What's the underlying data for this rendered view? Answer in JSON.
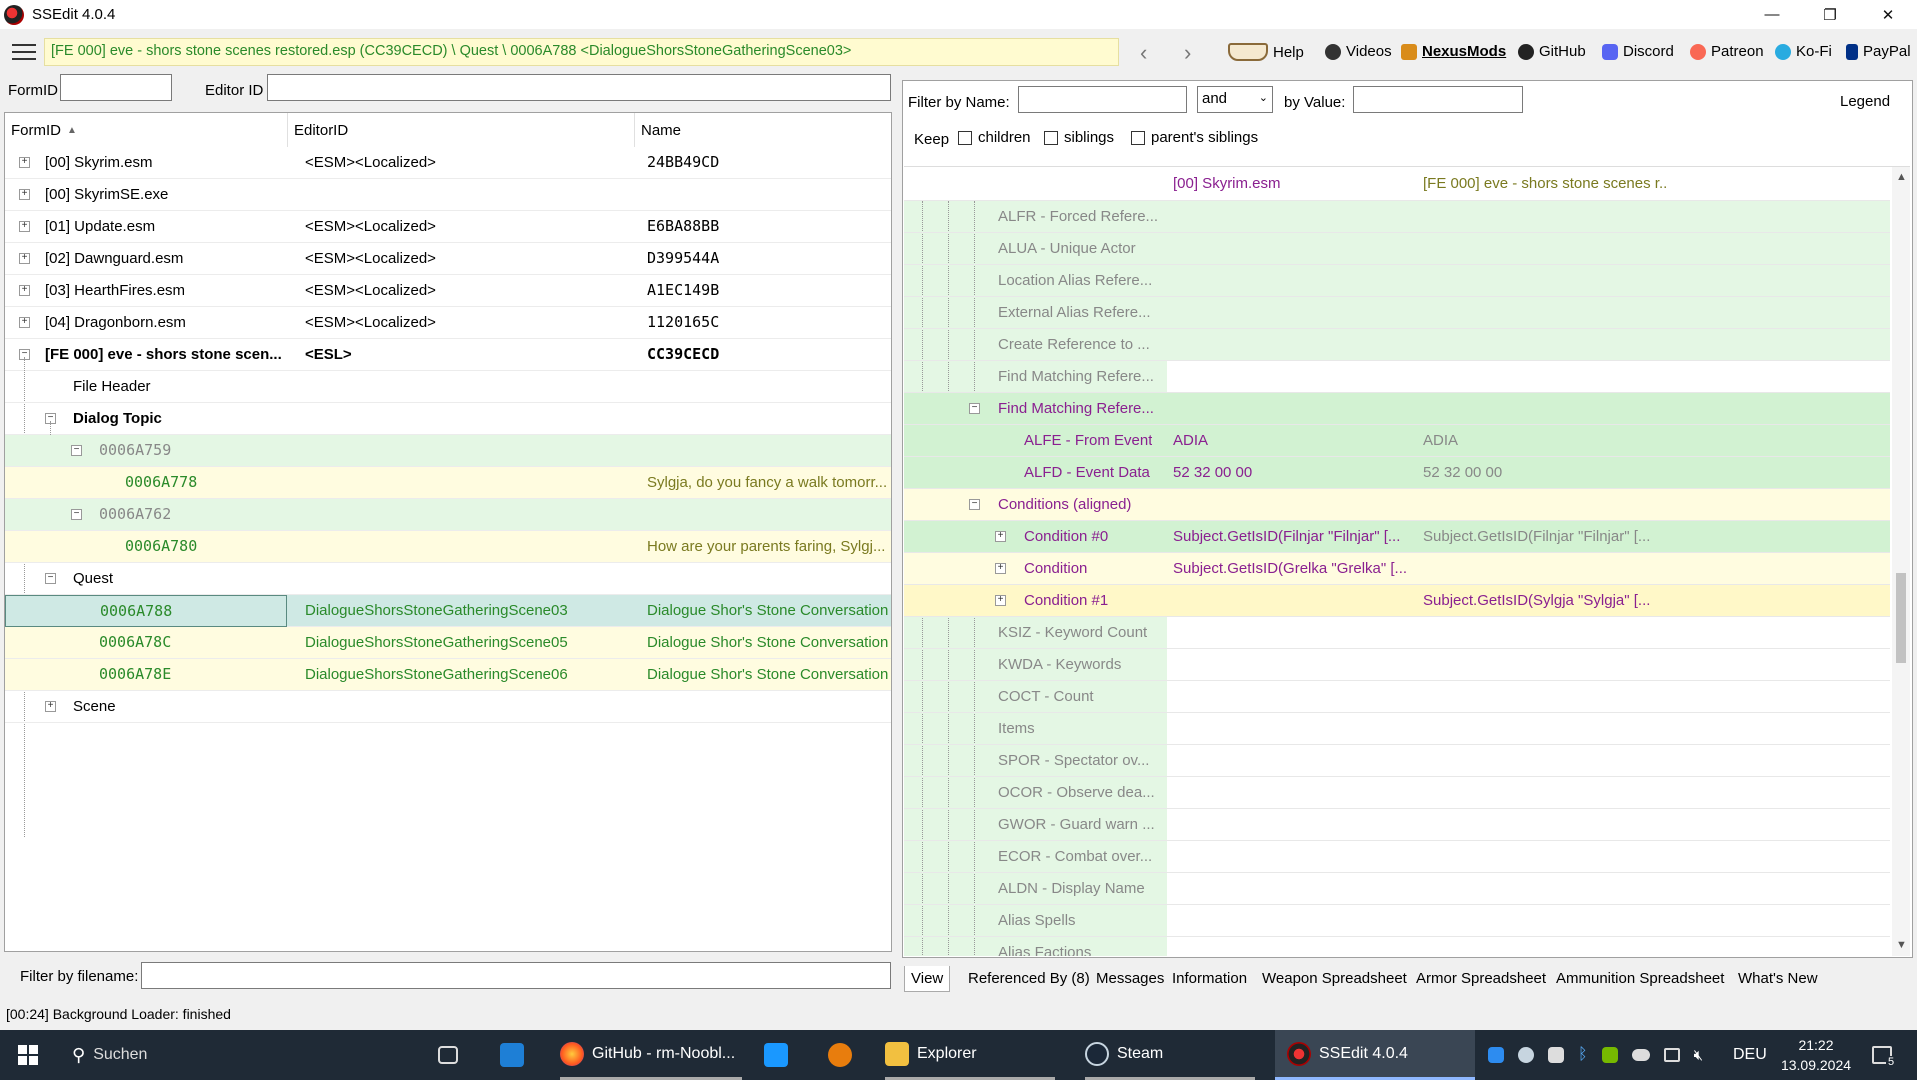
{
  "window": {
    "title": "SSEdit 4.0.4",
    "minimize": "—",
    "maximize": "❐",
    "close": "✕"
  },
  "nav": {
    "path": "[FE 000] eve - shors stone scenes restored.esp (CC39CECD) \\ Quest \\ 0006A788 <DialogueShorsStoneGatheringScene03>",
    "back": "‹",
    "forward": "›",
    "links": [
      "Help",
      "Videos",
      "NexusMods",
      "GitHub",
      "Discord",
      "Patreon",
      "Ko-Fi",
      "PayPal"
    ]
  },
  "left_filter": {
    "formid_label": "FormID",
    "editorid_label": "Editor ID",
    "formid_value": "",
    "editorid_value": ""
  },
  "left_grid": {
    "headers": [
      "FormID",
      "EditorID",
      "Name"
    ],
    "rows": [
      {
        "c1": "[00] Skyrim.esm",
        "c2": "<ESM><Localized>",
        "c3": "24BB49CD"
      },
      {
        "c1": "[00] SkyrimSE.exe",
        "c2": "",
        "c3": ""
      },
      {
        "c1": "[01] Update.esm",
        "c2": "<ESM><Localized>",
        "c3": "E6BA88BB"
      },
      {
        "c1": "[02] Dawnguard.esm",
        "c2": "<ESM><Localized>",
        "c3": "D399544A"
      },
      {
        "c1": "[03] HearthFires.esm",
        "c2": "<ESM><Localized>",
        "c3": "A1EC149B"
      },
      {
        "c1": "[04] Dragonborn.esm",
        "c2": "<ESM><Localized>",
        "c3": "1120165C"
      },
      {
        "c1": "[FE 000] eve - shors stone scen...",
        "c2": "<ESL>",
        "c3": "CC39CECD"
      },
      {
        "c1": "File Header",
        "c2": "",
        "c3": ""
      },
      {
        "c1": "Dialog Topic",
        "c2": "",
        "c3": ""
      },
      {
        "c1": "0006A759",
        "c2": "",
        "c3": ""
      },
      {
        "c1": "0006A778",
        "c2": "",
        "c3": "Sylgja, do you fancy a walk tomorr..."
      },
      {
        "c1": "0006A762",
        "c2": "",
        "c3": ""
      },
      {
        "c1": "0006A780",
        "c2": "",
        "c3": "How are your parents faring, Sylgj..."
      },
      {
        "c1": "Quest",
        "c2": "",
        "c3": ""
      },
      {
        "c1": "0006A788",
        "c2": "DialogueShorsStoneGatheringScene03",
        "c3": "Dialogue Shor's Stone Conversation"
      },
      {
        "c1": "0006A78C",
        "c2": "DialogueShorsStoneGatheringScene05",
        "c3": "Dialogue Shor's Stone Conversation"
      },
      {
        "c1": "0006A78E",
        "c2": "DialogueShorsStoneGatheringScene06",
        "c3": "Dialogue Shor's Stone Conversation"
      },
      {
        "c1": "Scene",
        "c2": "",
        "c3": ""
      }
    ]
  },
  "filter_by_filename": {
    "label": "Filter by filename:",
    "value": ""
  },
  "right_filter": {
    "name_label": "Filter by Name:",
    "name_value": "",
    "op_value": "and",
    "value_label": "by Value:",
    "value_value": "",
    "legend": "Legend",
    "keep": "Keep",
    "children": "children",
    "siblings": "siblings",
    "parents_siblings": "parent's siblings"
  },
  "right_grid": {
    "col1": "[00] Skyrim.esm",
    "col2": "[FE 000] eve - shors stone scenes r...",
    "rows": [
      {
        "n": "ALFR - Forced Refere...",
        "v1": "",
        "v2": ""
      },
      {
        "n": "ALUA - Unique Actor",
        "v1": "",
        "v2": ""
      },
      {
        "n": "Location Alias Refere...",
        "v1": "",
        "v2": ""
      },
      {
        "n": "External Alias Refere...",
        "v1": "",
        "v2": ""
      },
      {
        "n": "Create Reference to ...",
        "v1": "",
        "v2": ""
      },
      {
        "n": "Find Matching Refere...",
        "v1": "",
        "v2": ""
      },
      {
        "n": "Find Matching Refere...",
        "v1": "",
        "v2": ""
      },
      {
        "n": "ALFE - From Event",
        "v1": "ADIA",
        "v2": "ADIA"
      },
      {
        "n": "ALFD - Event Data",
        "v1": "52 32 00 00",
        "v2": "52 32 00 00"
      },
      {
        "n": "Conditions (aligned)",
        "v1": "",
        "v2": ""
      },
      {
        "n": "Condition #0",
        "v1": "Subject.GetIsID(Filnjar \"Filnjar\" [...",
        "v2": "Subject.GetIsID(Filnjar \"Filnjar\" [..."
      },
      {
        "n": "Condition",
        "v1": "Subject.GetIsID(Grelka \"Grelka\" [...",
        "v2": ""
      },
      {
        "n": "Condition #1",
        "v1": "",
        "v2": "Subject.GetIsID(Sylgja \"Sylgja\" [..."
      },
      {
        "n": "KSIZ - Keyword Count",
        "v1": "",
        "v2": ""
      },
      {
        "n": "KWDA - Keywords",
        "v1": "",
        "v2": ""
      },
      {
        "n": "COCT - Count",
        "v1": "",
        "v2": ""
      },
      {
        "n": "Items",
        "v1": "",
        "v2": ""
      },
      {
        "n": "SPOR - Spectator ov...",
        "v1": "",
        "v2": ""
      },
      {
        "n": "OCOR - Observe dea...",
        "v1": "",
        "v2": ""
      },
      {
        "n": "GWOR - Guard warn ...",
        "v1": "",
        "v2": ""
      },
      {
        "n": "ECOR - Combat over...",
        "v1": "",
        "v2": ""
      },
      {
        "n": "ALDN - Display Name",
        "v1": "",
        "v2": ""
      },
      {
        "n": "Alias Spells",
        "v1": "",
        "v2": ""
      },
      {
        "n": "Alias Factions",
        "v1": "",
        "v2": ""
      }
    ]
  },
  "tabs": [
    "View",
    "Referenced By (8)",
    "Messages",
    "Information",
    "Weapon Spreadsheet",
    "Armor Spreadsheet",
    "Ammunition Spreadsheet",
    "What's New"
  ],
  "status": "[00:24] Background Loader: finished",
  "taskbar": {
    "search": "Suchen",
    "firefox": "GitHub - rm-Noobl...",
    "explorer": "Explorer",
    "steam": "Steam",
    "ssedit": "SSEdit 4.0.4",
    "lang": "DEU",
    "time": "21:22",
    "date": "13.09.2024",
    "notif_count": "5"
  }
}
